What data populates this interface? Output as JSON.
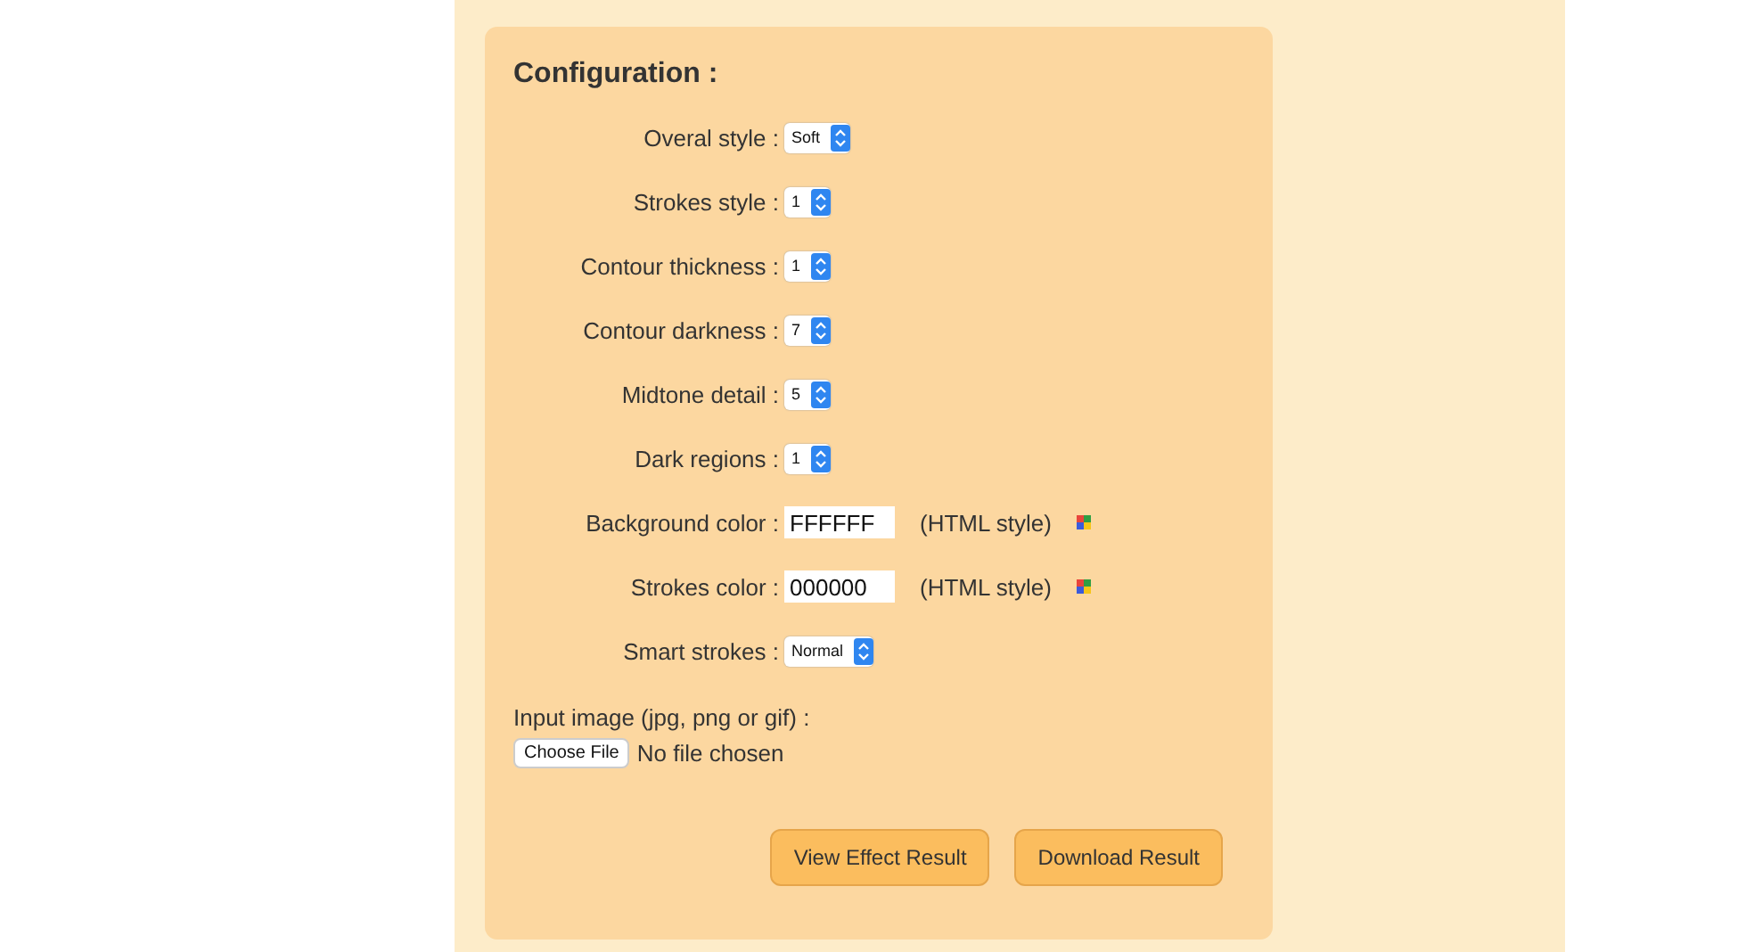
{
  "title": "Configuration :",
  "rows": [
    {
      "kind": "select",
      "label": "Overal style :",
      "value": "Soft"
    },
    {
      "kind": "select",
      "label": "Strokes style :",
      "value": "1"
    },
    {
      "kind": "select",
      "label": "Contour thickness :",
      "value": "1"
    },
    {
      "kind": "select",
      "label": "Contour darkness :",
      "value": "7"
    },
    {
      "kind": "select",
      "label": "Midtone detail :",
      "value": "5"
    },
    {
      "kind": "select",
      "label": "Dark regions :",
      "value": "1"
    },
    {
      "kind": "color",
      "label": "Background color :",
      "value": "FFFFFF",
      "hint": "(HTML style)"
    },
    {
      "kind": "color",
      "label": "Strokes color :",
      "value": "000000",
      "hint": "(HTML style)"
    },
    {
      "kind": "select",
      "label": "Smart strokes :",
      "value": "Normal"
    }
  ],
  "file": {
    "label": "Input image (jpg, png or gif) :",
    "button": "Choose File",
    "status": "No file chosen"
  },
  "buttons": [
    "View Effect Result",
    "Download Result"
  ]
}
